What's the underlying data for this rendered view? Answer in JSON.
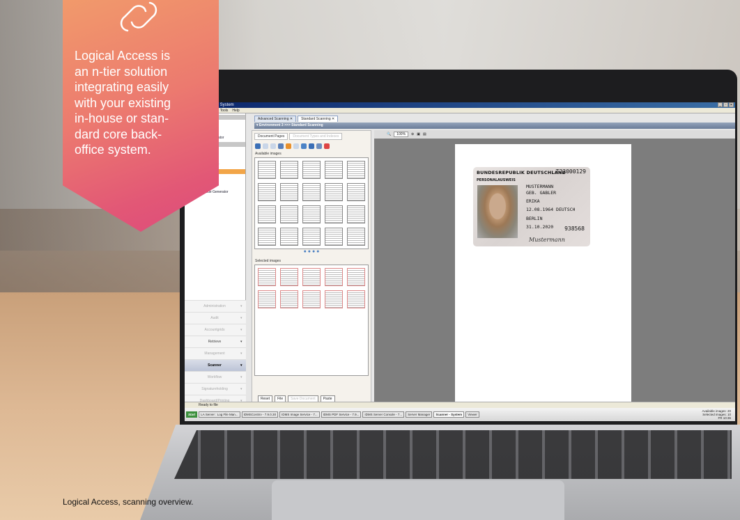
{
  "overlay": {
    "lines": [
      "Logical Access is",
      "an n-tier solution",
      "integrating easily",
      "with your existing",
      "in-house or stan-",
      "dard core back-",
      "office system."
    ],
    "icon": "link-icon",
    "color_top": "#f19a6b",
    "color_bottom": "#dc4b7c"
  },
  "caption": "Logical Access, scanning overview.",
  "screen": {
    "window_title": "er - System",
    "menu": [
      "odules",
      "Tools",
      "Help"
    ],
    "nav_items": [
      "d Scanning",
      "ed Scanning",
      "Find",
      "rcode Generator",
      "d Scanning",
      "d Scanning",
      "nd",
      "de Generator",
      "Scanning",
      "d Scanning",
      "Find",
      "Barcode Generator"
    ],
    "nav_sections": [
      {
        "label": "Administration",
        "state": "dim"
      },
      {
        "label": "Audit",
        "state": "dim"
      },
      {
        "label": "Accountgrids",
        "state": "dim"
      },
      {
        "label": "Retrieve",
        "state": "normal"
      },
      {
        "label": "Management",
        "state": "dim"
      },
      {
        "label": "Scanner",
        "state": "active"
      },
      {
        "label": "Workflow",
        "state": "dim"
      },
      {
        "label": "Signatureholding",
        "state": "dim"
      },
      {
        "label": "Dashboard/Printing",
        "state": "dim"
      }
    ],
    "tabs": [
      "Advanced Scanning ✕",
      "Standard Scanning ✕"
    ],
    "env_bar": "▾ Environment 3 >>> Standard Scanning",
    "sub_tabs": [
      "Document Pages",
      "Document Types and Indexes"
    ],
    "available_label": "Available images",
    "selected_label": "Selected images",
    "buttons": [
      "Reset",
      "File",
      "Save Document",
      "Paste"
    ],
    "zoom": "100%",
    "id_card": {
      "country": "BUNDESREPUBLIK DEUTSCHLAND",
      "doc_number": "T22000129",
      "type": "PERSONALAUSWEIS",
      "name": "MUSTERMANN",
      "birth_name": "GEB. GABLER",
      "given": "ERIKA",
      "dob": "12.08.1964 DEUTSCH",
      "place": "BERLIN",
      "expiry": "31.10.2020",
      "can": "938568",
      "signature": "Mustermann"
    },
    "status": "Ready to file",
    "taskbar": {
      "start": "Start",
      "tasks": [
        "LA Server : Log File Man...",
        "IDMSConSrv - 7.9.0.30",
        "IDMS Image Service - 7...",
        "IDMS PDF Service - 7.9...",
        "IDMS Server Console - 7...",
        "Server Manager",
        "Scanner - System",
        "Viewer"
      ],
      "available_images": "Available images: 20",
      "selected_images": "Selected images: 10",
      "lang": "FR",
      "time": "10:36"
    }
  }
}
